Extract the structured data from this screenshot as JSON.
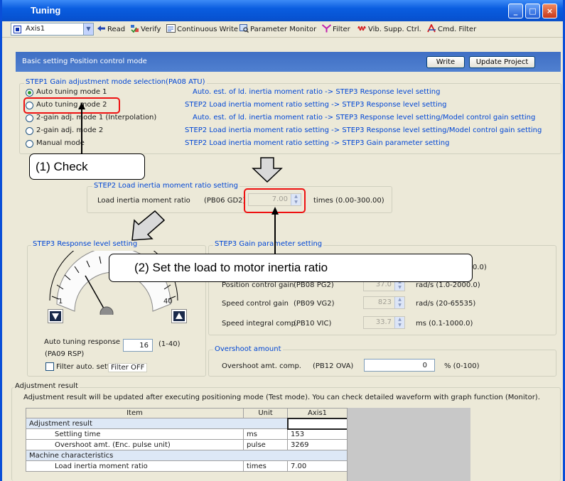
{
  "window": {
    "title": "Tuning"
  },
  "toolbar": {
    "axis": "Axis1",
    "read": "Read",
    "verify": "Verify",
    "continuous_write": "Continuous Write",
    "parameter_monitor": "Parameter Monitor",
    "filter": "Filter",
    "vib_supp": "Vib. Supp. Ctrl.",
    "cmd_filter": "Cmd. Filter"
  },
  "panel": {
    "header": "Basic setting Position control mode",
    "write_button": "Write",
    "update_button": "Update Project"
  },
  "step1": {
    "legend": "STEP1 Gain adjustment mode selection(PA08 ATU)",
    "modes": [
      {
        "label": "Auto tuning mode 1",
        "desc": "Auto. est. of ld. inertia moment ratio  -> STEP3 Response level setting",
        "selected": true
      },
      {
        "label": "Auto tuning mode 2",
        "desc": "STEP2 Load inertia moment ratio setting  -> STEP3 Response level setting",
        "selected": false
      },
      {
        "label": "2-gain adj. mode 1 (Interpolation)",
        "desc": "Auto. est. of ld. inertia moment ratio  -> STEP3 Response level setting/Model control gain setting",
        "selected": false
      },
      {
        "label": "2-gain adj. mode 2",
        "desc": "STEP2 Load inertia moment ratio setting  -> STEP3 Response level setting/Model control gain setting",
        "selected": false
      },
      {
        "label": "Manual mode",
        "desc": "STEP2 Load inertia moment ratio setting  -> STEP3 Gain parameter setting",
        "selected": false
      }
    ]
  },
  "step2": {
    "legend": "STEP2 Load inertia moment ratio setting",
    "label": "Load inertia moment ratio",
    "param": "(PB06 GD2)",
    "value": "7.00",
    "range": "times (0.00-300.00)"
  },
  "step3_response": {
    "legend": "STEP3 Response level setting",
    "min": "1",
    "max": "40",
    "auto_label": "Auto tuning response",
    "auto_param": "(PA09 RSP)",
    "auto_value": "16",
    "auto_range": "(1-40)",
    "filter_label": "Filter auto. setting",
    "filter_value": "Filter OFF"
  },
  "step3_gain": {
    "legend": "STEP3 Gain parameter setting",
    "rows": [
      {
        "label": "",
        "param": "",
        "value": "",
        "range": "0.0)"
      },
      {
        "label": "Position control gain",
        "param": "(PB08 PG2)",
        "value": "37.0",
        "range": "rad/s (1.0-2000.0)"
      },
      {
        "label": "Speed control gain",
        "param": "(PB09 VG2)",
        "value": "823",
        "range": "rad/s (20-65535)"
      },
      {
        "label": "Speed integral comp.",
        "param": "(PB10 VIC)",
        "value": "33.7",
        "range": "ms (0.1-1000.0)"
      }
    ]
  },
  "overshoot": {
    "legend": "Overshoot amount",
    "label": "Overshoot amt. comp.",
    "param": "(PB12 OVA)",
    "value": "0",
    "range": "% (0-100)"
  },
  "adjustment": {
    "legend": "Adjustment result",
    "note": "Adjustment result will be updated after executing positioning mode (Test mode). You can check detailed waveform with graph function (Monitor).",
    "columns": [
      "Item",
      "Unit",
      "Axis1"
    ],
    "groups": [
      "Adjustment result",
      "Machine characteristics"
    ],
    "rows": [
      {
        "item": "Settling time",
        "unit": "ms",
        "value": "153"
      },
      {
        "item": "Overshoot amt. (Enc. pulse unit)",
        "unit": "pulse",
        "value": "3269"
      },
      {
        "item": "Load inertia moment ratio",
        "unit": "times",
        "value": "7.00"
      }
    ]
  },
  "callouts": {
    "check": "(1)  Check",
    "set": "(2)  Set the load to motor inertia ratio"
  }
}
